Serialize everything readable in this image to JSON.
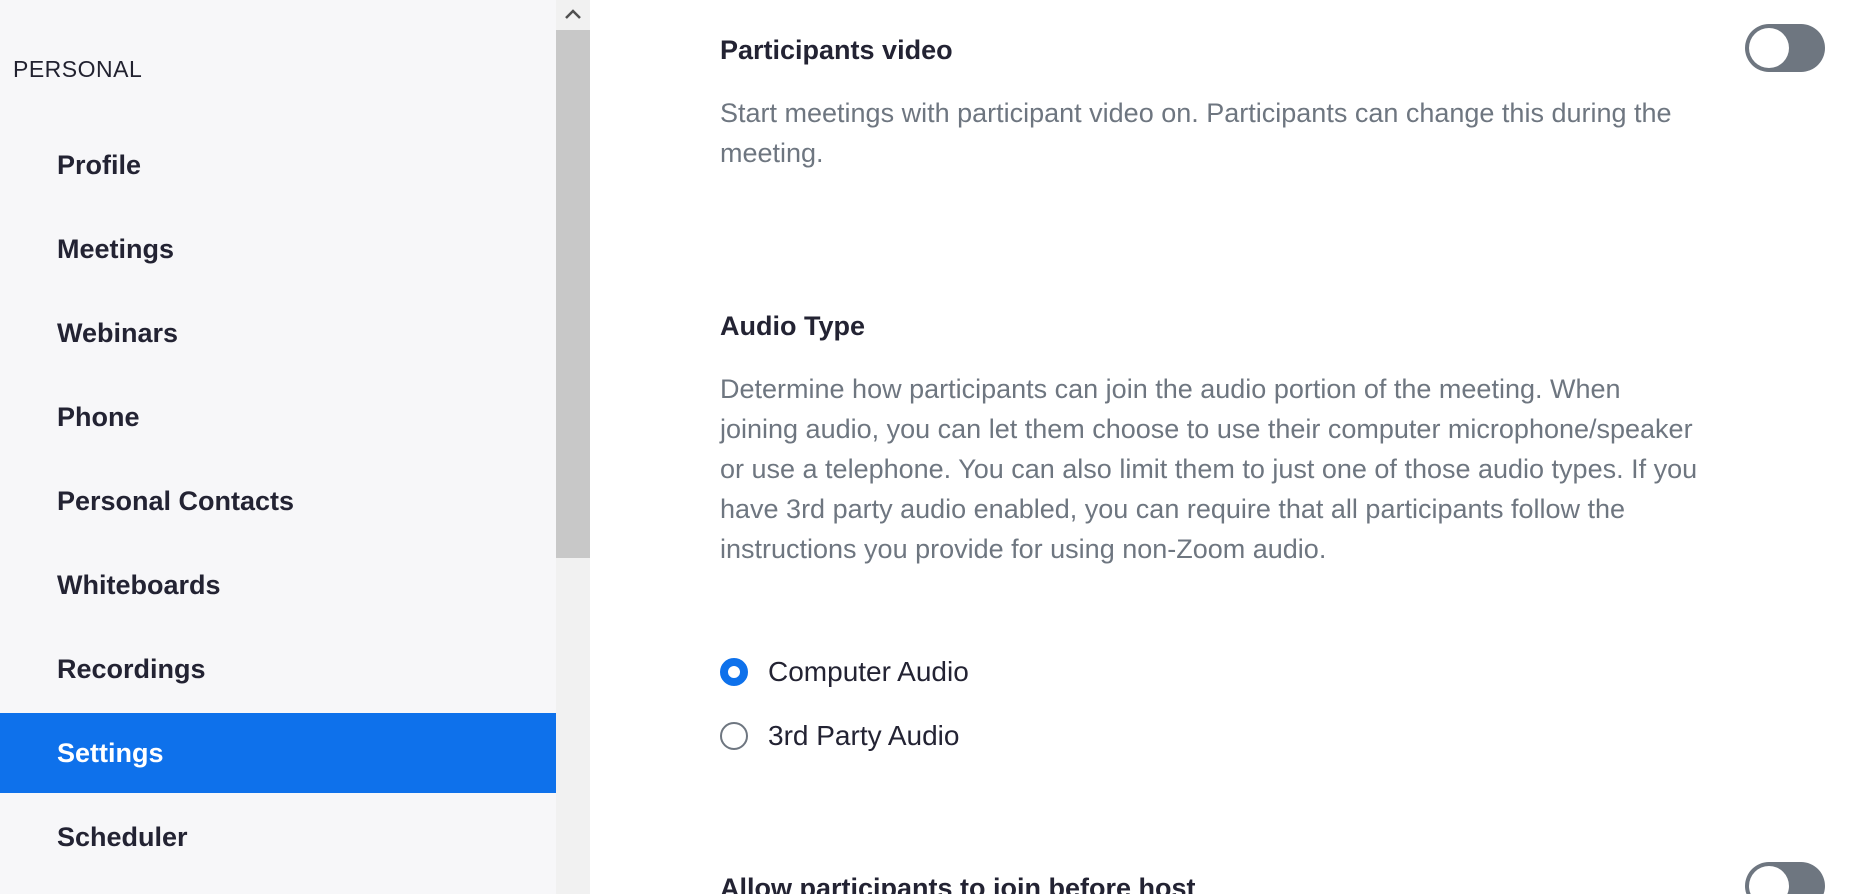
{
  "sidebar": {
    "section_label": "PERSONAL",
    "items": [
      {
        "label": "Profile"
      },
      {
        "label": "Meetings"
      },
      {
        "label": "Webinars"
      },
      {
        "label": "Phone"
      },
      {
        "label": "Personal Contacts"
      },
      {
        "label": "Whiteboards"
      },
      {
        "label": "Recordings"
      },
      {
        "label": "Settings",
        "active": true
      },
      {
        "label": "Scheduler"
      }
    ]
  },
  "settings": {
    "participants_video": {
      "title": "Participants video",
      "description": "Start meetings with participant video on. Participants can change this during the meeting.",
      "enabled": false
    },
    "audio_type": {
      "title": "Audio Type",
      "description": "Determine how participants can join the audio portion of the meeting. When joining audio, you can let them choose to use their computer microphone/speaker or use a telephone. You can also limit them to just one of those audio types. If you have 3rd party audio enabled, you can require that all participants follow the instructions you provide for using non-Zoom audio.",
      "options": [
        {
          "label": "Computer Audio",
          "selected": true
        },
        {
          "label": "3rd Party Audio",
          "selected": false
        }
      ]
    },
    "join_before_host": {
      "title": "Allow participants to join before host",
      "enabled": false
    }
  },
  "colors": {
    "accent": "#0e71eb",
    "toggle_off": "#6e7680"
  }
}
